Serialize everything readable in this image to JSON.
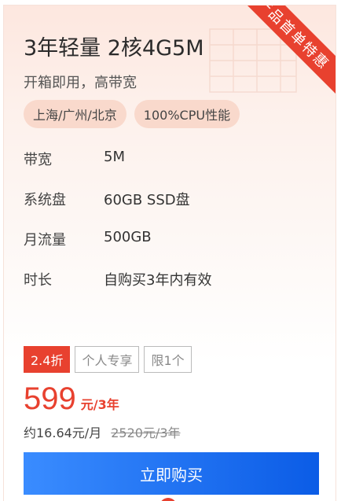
{
  "card": {
    "title": "3年轻量 2核4G5M",
    "subtitle": "开箱即用，高带宽",
    "ribbon": "产品首单特惠",
    "tags": [
      "上海/广州/北京",
      "100%CPU性能"
    ],
    "specs": [
      {
        "label": "带宽",
        "value": "5M"
      },
      {
        "label": "系统盘",
        "value": "60GB SSD盘"
      },
      {
        "label": "月流量",
        "value": "500GB"
      },
      {
        "label": "时长",
        "value": "自购买3年内有效"
      }
    ],
    "badges": {
      "discount": "2.4折",
      "personal": "个人专享",
      "limit": "限1个"
    },
    "price": {
      "amount": "599",
      "unit": "元/3年",
      "monthly": "约16.64元/月",
      "original": "2520元/3年"
    },
    "buy_label": "立即购买"
  },
  "colors": {
    "accent": "#e8412f",
    "button_start": "#3a8cff",
    "button_end": "#0b5ce6"
  }
}
